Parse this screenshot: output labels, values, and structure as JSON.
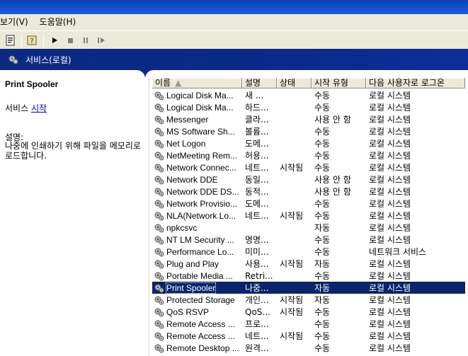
{
  "menu": {
    "view": "보기(V)",
    "help": "도움말(H)"
  },
  "banner": {
    "title": "서비스(로컬)"
  },
  "left": {
    "service_name": "Print Spooler",
    "action_prefix": "서비스 ",
    "action_link": "시작",
    "desc_label": "설명:",
    "desc_text": "나중에 인쇄하기 위해 파일을 메모리로 로드합니다."
  },
  "table": {
    "columns": [
      "이름",
      "설명",
      "상태",
      "시작 유형",
      "다음 사용자로 로그온"
    ],
    "rows": [
      {
        "name": "Logical Disk Ma...",
        "desc": "새 ...",
        "status": "",
        "startup": "수동",
        "logon": "로컬 시스템"
      },
      {
        "name": "Logical Disk Ma...",
        "desc": "하드...",
        "status": "",
        "startup": "수동",
        "logon": "로컬 시스템"
      },
      {
        "name": "Messenger",
        "desc": "클라...",
        "status": "",
        "startup": "사용 안 함",
        "logon": "로컬 시스템"
      },
      {
        "name": "MS Software Sh...",
        "desc": "볼륨...",
        "status": "",
        "startup": "수동",
        "logon": "로컬 시스템"
      },
      {
        "name": "Net Logon",
        "desc": "도메...",
        "status": "",
        "startup": "수동",
        "logon": "로컬 시스템"
      },
      {
        "name": "NetMeeting Rem...",
        "desc": "허용...",
        "status": "",
        "startup": "수동",
        "logon": "로컬 시스템"
      },
      {
        "name": "Network Connec...",
        "desc": "네트...",
        "status": "시작됨",
        "startup": "수동",
        "logon": "로컬 시스템"
      },
      {
        "name": "Network DDE",
        "desc": "동일...",
        "status": "",
        "startup": "사용 안 함",
        "logon": "로컬 시스템"
      },
      {
        "name": "Network DDE DS...",
        "desc": "동적...",
        "status": "",
        "startup": "사용 안 함",
        "logon": "로컬 시스템"
      },
      {
        "name": "Network Provisio...",
        "desc": "도메...",
        "status": "",
        "startup": "수동",
        "logon": "로컬 시스템"
      },
      {
        "name": "NLA(Network Lo...",
        "desc": "네트...",
        "status": "시작됨",
        "startup": "수동",
        "logon": "로컬 시스템"
      },
      {
        "name": "npkcsvc",
        "desc": "",
        "status": "",
        "startup": "자동",
        "logon": "로컬 시스템"
      },
      {
        "name": "NT LM Security ...",
        "desc": "명명...",
        "status": "",
        "startup": "수동",
        "logon": "로컬 시스템"
      },
      {
        "name": "Performance Lo...",
        "desc": "미미...",
        "status": "",
        "startup": "수동",
        "logon": "네트워크 서비스"
      },
      {
        "name": "Plug and Play",
        "desc": "사용...",
        "status": "시작됨",
        "startup": "자동",
        "logon": "로컬 시스템"
      },
      {
        "name": "Portable Media ...",
        "desc": "Retri...",
        "status": "",
        "startup": "수동",
        "logon": "로컬 시스템"
      },
      {
        "name": "Print Spooler",
        "desc": "나중...",
        "status": "",
        "startup": "자동",
        "logon": "로컬 시스템",
        "selected": true
      },
      {
        "name": "Protected Storage",
        "desc": "개인...",
        "status": "시작됨",
        "startup": "자동",
        "logon": "로컬 시스템"
      },
      {
        "name": "QoS RSVP",
        "desc": "QoS...",
        "status": "시작됨",
        "startup": "수동",
        "logon": "로컬 시스템"
      },
      {
        "name": "Remote Access ...",
        "desc": "프로...",
        "status": "",
        "startup": "수동",
        "logon": "로컬 시스템"
      },
      {
        "name": "Remote Access ...",
        "desc": "네트...",
        "status": "시작됨",
        "startup": "수동",
        "logon": "로컬 시스템"
      },
      {
        "name": "Remote Desktop ...",
        "desc": "원격...",
        "status": "",
        "startup": "수동",
        "logon": "로컬 시스템"
      }
    ]
  },
  "colors": {
    "banner": "#0c2a82",
    "selection": "#0a246a",
    "link": "#0000cc"
  },
  "icons": [
    "toolbar-properties-icon",
    "toolbar-help-icon",
    "play-icon",
    "stop-icon",
    "pause-icon",
    "restart-icon",
    "services-icon",
    "gear-icon"
  ]
}
